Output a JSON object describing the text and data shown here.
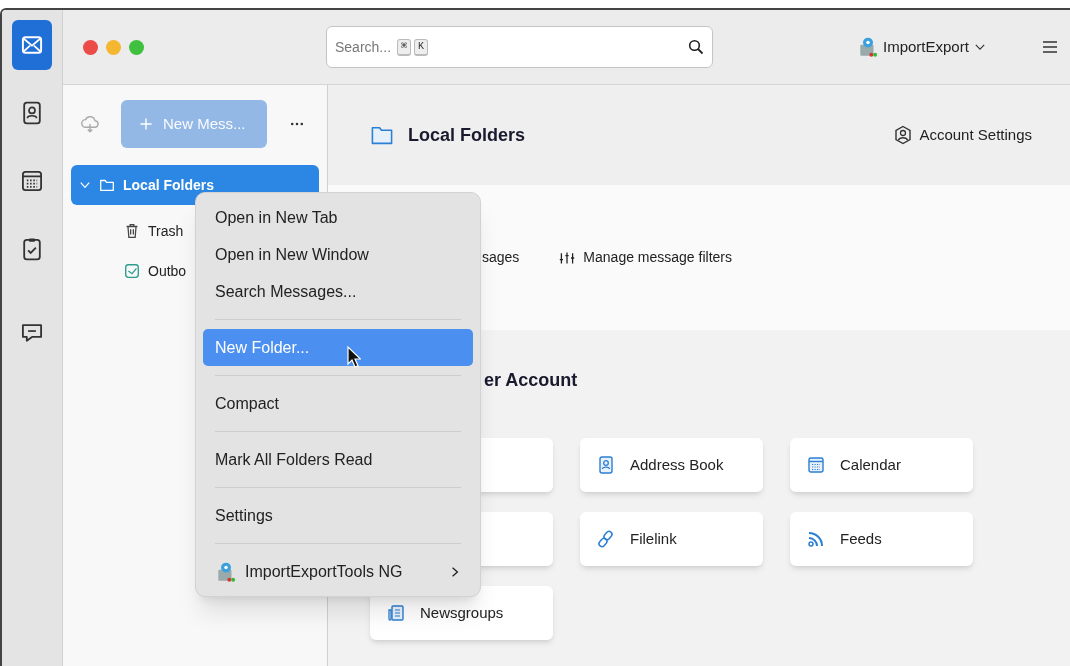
{
  "spaces_toolbar": [
    {
      "kind": "mail",
      "selected": true
    },
    {
      "kind": "address-book",
      "selected": false
    },
    {
      "kind": "calendar",
      "selected": false
    },
    {
      "kind": "tasks",
      "selected": false
    },
    {
      "kind": "chat",
      "selected": false
    }
  ],
  "search": {
    "placeholder": "Search...",
    "shortcut": [
      "⌘",
      "K"
    ]
  },
  "account_menu": {
    "label": "ImportExport"
  },
  "folder_pane": {
    "new_message": {
      "label": "New Mess...",
      "disabled": true
    },
    "folders": [
      {
        "name": "Local Folders",
        "kind": "account",
        "selected": true,
        "expanded": true,
        "children": [
          {
            "name": "Trash",
            "kind": "trash",
            "selected": false
          },
          {
            "name": "Outbo",
            "kind": "outbox",
            "selected": false
          }
        ]
      }
    ]
  },
  "main": {
    "title": "Local Folders",
    "account_settings": "Account Settings",
    "actions": [
      {
        "label": "sages",
        "kind": "plain"
      },
      {
        "label": "Manage message filters",
        "kind": "filters"
      }
    ],
    "heading": "er Account",
    "cards": [
      {
        "kind": "covered"
      },
      {
        "label": "Address Book",
        "kind": "address-book"
      },
      {
        "label": "Calendar",
        "kind": "calendar"
      },
      {
        "kind": "covered"
      },
      {
        "label": "Filelink",
        "kind": "filelink"
      },
      {
        "label": "Feeds",
        "kind": "feeds"
      },
      {
        "label": "Newsgroups",
        "kind": "newsgroups"
      }
    ]
  },
  "context_menu": {
    "groups": [
      [
        {
          "label": "Open in New Tab",
          "selected": false
        },
        {
          "label": "Open in New Window",
          "selected": false
        },
        {
          "label": "Search Messages...",
          "selected": false
        }
      ],
      [
        {
          "label": "New Folder...",
          "selected": true
        }
      ],
      [
        {
          "label": "Compact",
          "selected": false
        }
      ],
      [
        {
          "label": "Mark All Folders Read",
          "selected": false
        }
      ],
      [
        {
          "label": "Settings",
          "selected": false
        }
      ],
      [
        {
          "label": "ImportExportTools NG",
          "selected": false,
          "kind": "submenu"
        }
      ]
    ]
  }
}
